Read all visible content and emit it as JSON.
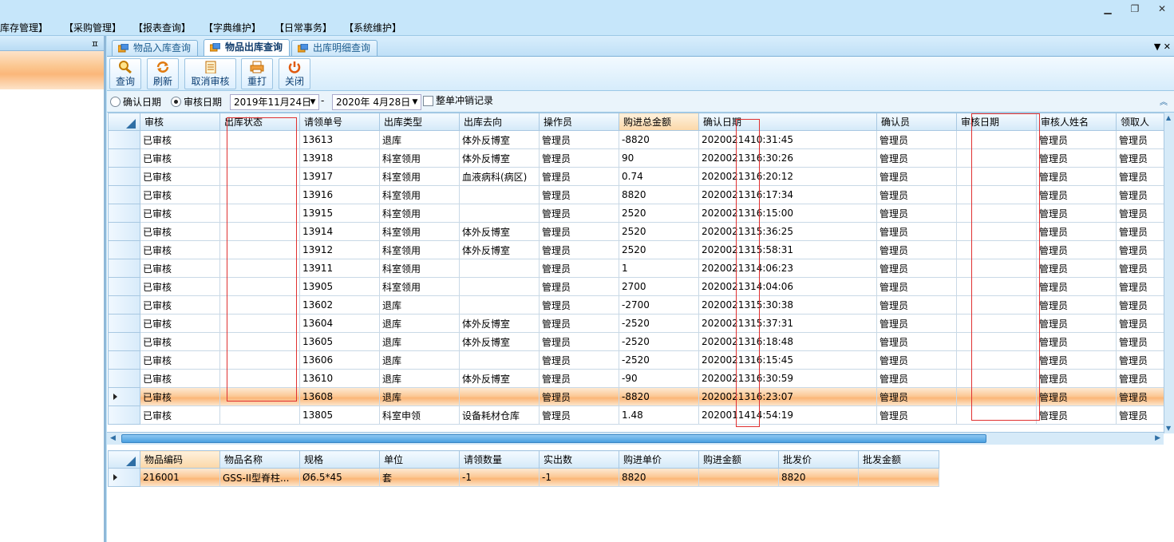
{
  "window": {
    "buttons": [
      "minimize",
      "restore",
      "close"
    ]
  },
  "menu": {
    "items": [
      "库存管理】",
      "【采购管理】",
      "【报表查询】",
      "【字典维护】",
      "【日常事务】",
      "【系统维护】"
    ]
  },
  "left_pane": {
    "pin": "ㅍ"
  },
  "tabs": [
    {
      "label": "物品入库查询",
      "active": false
    },
    {
      "label": "物品出库查询",
      "active": true
    },
    {
      "label": "出库明细查询",
      "active": false
    }
  ],
  "tab_close": "▼ ✕",
  "toolbar": {
    "query": "查询",
    "refresh": "刷新",
    "cancel_audit": "取消审核",
    "reprint": "重打",
    "close": "关闭"
  },
  "filter": {
    "confirm_date": "确认日期",
    "audit_date": "审核日期",
    "date_from": "2019年11月24日",
    "dash": "-",
    "date_to": "2020年  4月28日",
    "reverse_records": "整单冲销记录"
  },
  "master_grid": {
    "columns": [
      "审核",
      "出库状态",
      "请领单号",
      "出库类型",
      "出库去向",
      "操作员",
      "购进总金额",
      "确认日期",
      "确认员",
      "审核日期",
      "审核人姓名",
      "领取人"
    ],
    "rows": [
      [
        "已审核",
        "",
        "13613",
        "退库",
        "体外反博室",
        "管理员",
        "-8820",
        "2020021410:31:45",
        "管理员",
        "",
        "管理员",
        "管理员"
      ],
      [
        "已审核",
        "",
        "13918",
        "科室领用",
        "体外反博室",
        "管理员",
        "90",
        "2020021316:30:26",
        "管理员",
        "",
        "管理员",
        "管理员"
      ],
      [
        "已审核",
        "",
        "13917",
        "科室领用",
        "血液病科(病区)",
        "管理员",
        "0.74",
        "2020021316:20:12",
        "管理员",
        "",
        "管理员",
        "管理员"
      ],
      [
        "已审核",
        "",
        "13916",
        "科室领用",
        "",
        "管理员",
        "8820",
        "2020021316:17:34",
        "管理员",
        "",
        "管理员",
        "管理员"
      ],
      [
        "已审核",
        "",
        "13915",
        "科室领用",
        "",
        "管理员",
        "2520",
        "2020021316:15:00",
        "管理员",
        "",
        "管理员",
        "管理员"
      ],
      [
        "已审核",
        "",
        "13914",
        "科室领用",
        "体外反博室",
        "管理员",
        "2520",
        "2020021315:36:25",
        "管理员",
        "",
        "管理员",
        "管理员"
      ],
      [
        "已审核",
        "",
        "13912",
        "科室领用",
        "体外反博室",
        "管理员",
        "2520",
        "2020021315:58:31",
        "管理员",
        "",
        "管理员",
        "管理员"
      ],
      [
        "已审核",
        "",
        "13911",
        "科室领用",
        "",
        "管理员",
        "1",
        "2020021314:06:23",
        "管理员",
        "",
        "管理员",
        "管理员"
      ],
      [
        "已审核",
        "",
        "13905",
        "科室领用",
        "",
        "管理员",
        "2700",
        "2020021314:04:06",
        "管理员",
        "",
        "管理员",
        "管理员"
      ],
      [
        "已审核",
        "",
        "13602",
        "退库",
        "",
        "管理员",
        "-2700",
        "2020021315:30:38",
        "管理员",
        "",
        "管理员",
        "管理员"
      ],
      [
        "已审核",
        "",
        "13604",
        "退库",
        "体外反博室",
        "管理员",
        "-2520",
        "2020021315:37:31",
        "管理员",
        "",
        "管理员",
        "管理员"
      ],
      [
        "已审核",
        "",
        "13605",
        "退库",
        "体外反博室",
        "管理员",
        "-2520",
        "2020021316:18:48",
        "管理员",
        "",
        "管理员",
        "管理员"
      ],
      [
        "已审核",
        "",
        "13606",
        "退库",
        "",
        "管理员",
        "-2520",
        "2020021316:15:45",
        "管理员",
        "",
        "管理员",
        "管理员"
      ],
      [
        "已审核",
        "",
        "13610",
        "退库",
        "体外反博室",
        "管理员",
        "-90",
        "2020021316:30:59",
        "管理员",
        "",
        "管理员",
        "管理员"
      ],
      [
        "已审核",
        "",
        "13608",
        "退库",
        "",
        "管理员",
        "-8820",
        "2020021316:23:07",
        "管理员",
        "",
        "管理员",
        "管理员"
      ],
      [
        "已审核",
        "",
        "13805",
        "科室申领",
        "设备耗材仓库",
        "管理员",
        "1.48",
        "2020011414:54:19",
        "管理员",
        "",
        "管理员",
        "管理员"
      ]
    ],
    "selected_row": 14
  },
  "detail_grid": {
    "columns": [
      "物品编码",
      "物品名称",
      "规格",
      "单位",
      "请领数量",
      "实出数",
      "购进单价",
      "购进金额",
      "批发价",
      "批发金额"
    ],
    "rows": [
      [
        "216001",
        "GSS-II型脊柱...",
        "Ø6.5*45",
        "套",
        "-1",
        "-1",
        "8820",
        "",
        "8820",
        ""
      ]
    ]
  },
  "colors": {
    "accent": "#fbb677",
    "frame": "#bfe3f8",
    "annotation": "#e03030"
  }
}
